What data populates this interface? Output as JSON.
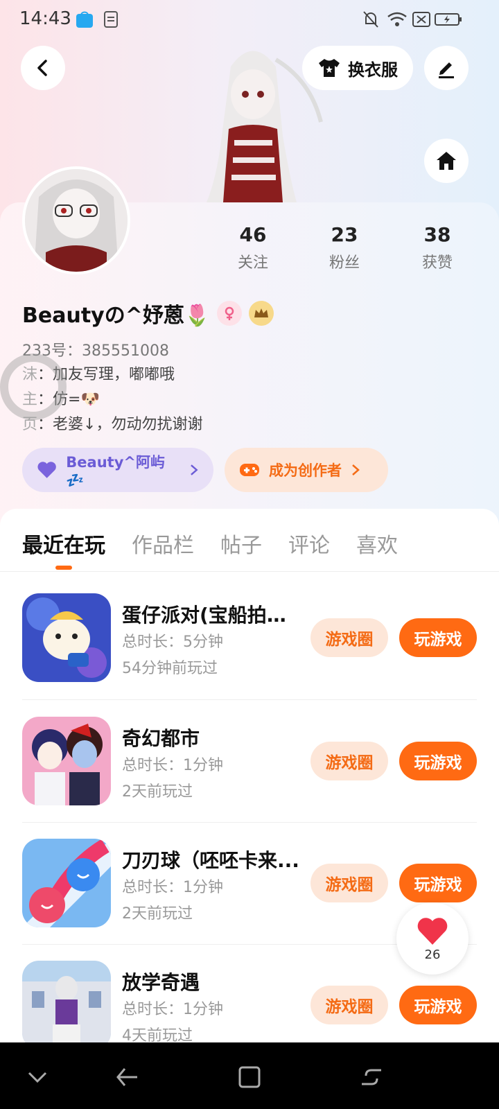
{
  "status_bar": {
    "time": "14:43"
  },
  "header": {
    "back_icon": "chevron-left-icon",
    "change_clothes_label": "换衣服",
    "edit_icon": "pen-icon",
    "home_icon": "home-icon"
  },
  "profile": {
    "stats": [
      {
        "value": "46",
        "label": "关注"
      },
      {
        "value": "23",
        "label": "粉丝"
      },
      {
        "value": "38",
        "label": "获赞"
      }
    ],
    "name": "Beautyの^妤蒽🌷",
    "uid": "233号：385551008",
    "bio": [
      {
        "key": "沫",
        "text": "：加友写理，嘟嘟哦"
      },
      {
        "key": "主",
        "text": "：仿=🐶"
      },
      {
        "key": "页",
        "text": "：老婆↓，勿动勿扰谢谢"
      }
    ],
    "couple_chip": "Beauty^阿屿💤",
    "creator_chip": "成为创作者"
  },
  "tabs": [
    "最近在玩",
    "作品栏",
    "帖子",
    "评论",
    "喜欢"
  ],
  "games": [
    {
      "title": "蛋仔派对(宝船拍卖...",
      "duration": "总时长：5分钟",
      "last": "54分钟前玩过",
      "circle_label": "游戏圈",
      "play_label": "玩游戏"
    },
    {
      "title": "奇幻都市",
      "duration": "总时长：1分钟",
      "last": "2天前玩过",
      "circle_label": "游戏圈",
      "play_label": "玩游戏"
    },
    {
      "title": "刀刃球（呸呸卡来...",
      "duration": "总时长：1分钟",
      "last": "2天前玩过",
      "circle_label": "游戏圈",
      "play_label": "玩游戏"
    },
    {
      "title": "放学奇遇",
      "duration": "总时长：1分钟",
      "last": "4天前玩过",
      "circle_label": "游戏圈",
      "play_label": "玩游戏"
    }
  ],
  "like": {
    "count": "26"
  },
  "colors": {
    "accent": "#ff6a13",
    "accent_soft": "#fde6d8",
    "couple_chip_bg": "#e8e0f7",
    "couple_chip_text": "#6b5cd6"
  }
}
